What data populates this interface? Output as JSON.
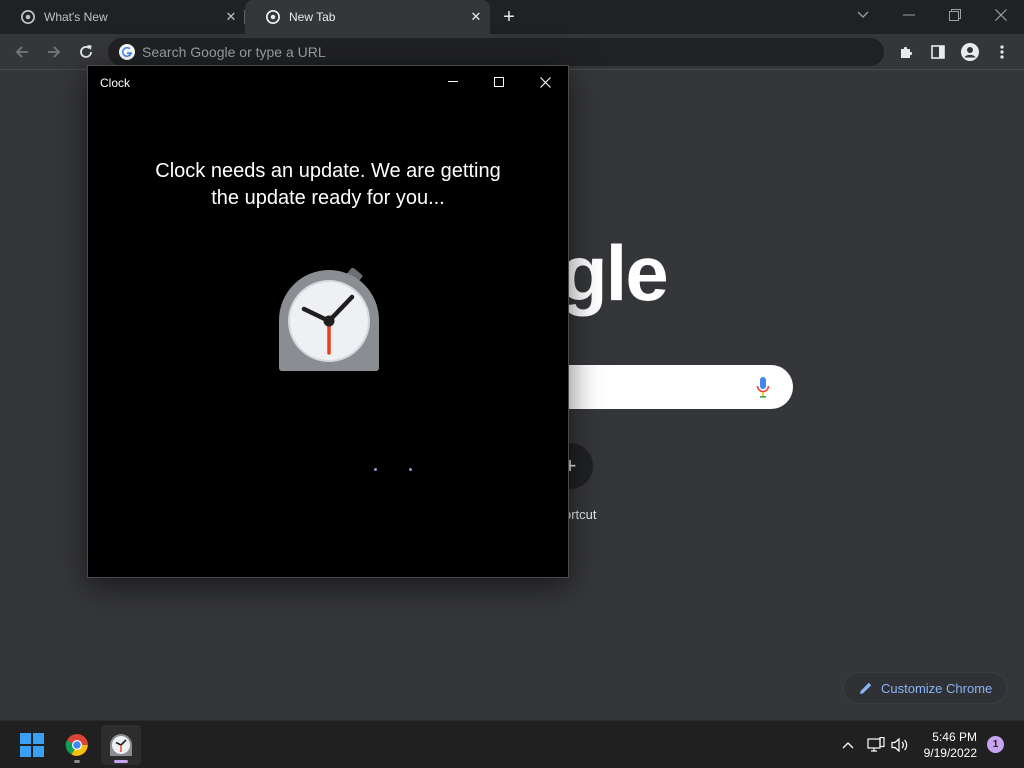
{
  "browser": {
    "tabs": [
      {
        "label": "What's New"
      },
      {
        "label": "New Tab"
      }
    ],
    "omnibox": {
      "placeholder": "Search Google or type a URL"
    }
  },
  "ntp": {
    "logo_fragment": "gle",
    "shortcut_label": "ortcut",
    "shortcut_plus": "+",
    "customize_label": "Customize Chrome"
  },
  "clock_window": {
    "title": "Clock",
    "message": "Clock needs an update. We are getting the update ready for you..."
  },
  "taskbar": {
    "time": "5:46 PM",
    "date": "9/19/2022",
    "notification_count": "1"
  },
  "colors": {
    "accent": "#8ab4f8",
    "clock_hand": "#e8401c",
    "loading_dots": "#9f8fd9"
  }
}
